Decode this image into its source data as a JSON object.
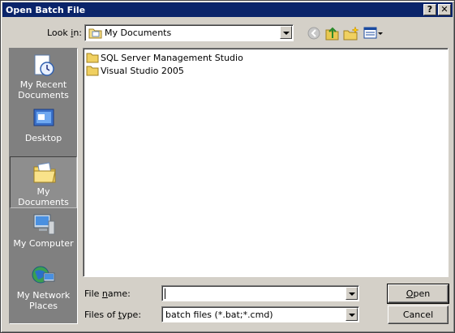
{
  "window": {
    "title": "Open Batch File",
    "help_glyph": "?",
    "close_glyph": "✕"
  },
  "look_in": {
    "label_pre": "Look ",
    "label_u": "i",
    "label_post": "n:",
    "value": "My Documents"
  },
  "places": [
    {
      "label": "My Recent Documents",
      "icon": "recent-documents-icon"
    },
    {
      "label": "Desktop",
      "icon": "desktop-icon"
    },
    {
      "label": "My Documents",
      "icon": "my-documents-icon",
      "selected": true
    },
    {
      "label": "My Computer",
      "icon": "my-computer-icon"
    },
    {
      "label": "My Network Places",
      "icon": "network-places-icon"
    }
  ],
  "files": [
    {
      "name": "SQL Server Management Studio",
      "icon": "folder-icon"
    },
    {
      "name": "Visual Studio 2005",
      "icon": "folder-icon"
    }
  ],
  "file_name": {
    "label_pre": "File ",
    "label_u": "n",
    "label_post": "ame:",
    "value": ""
  },
  "file_type": {
    "label_pre": "Files of ",
    "label_u": "t",
    "label_post": "ype:",
    "value": "batch files (*.bat;*.cmd)"
  },
  "buttons": {
    "open_u": "O",
    "open_rest": "pen",
    "cancel": "Cancel"
  },
  "colors": {
    "titlebar": "#0a246a",
    "dialog": "#d4d0c8",
    "places_bar": "#808080"
  }
}
